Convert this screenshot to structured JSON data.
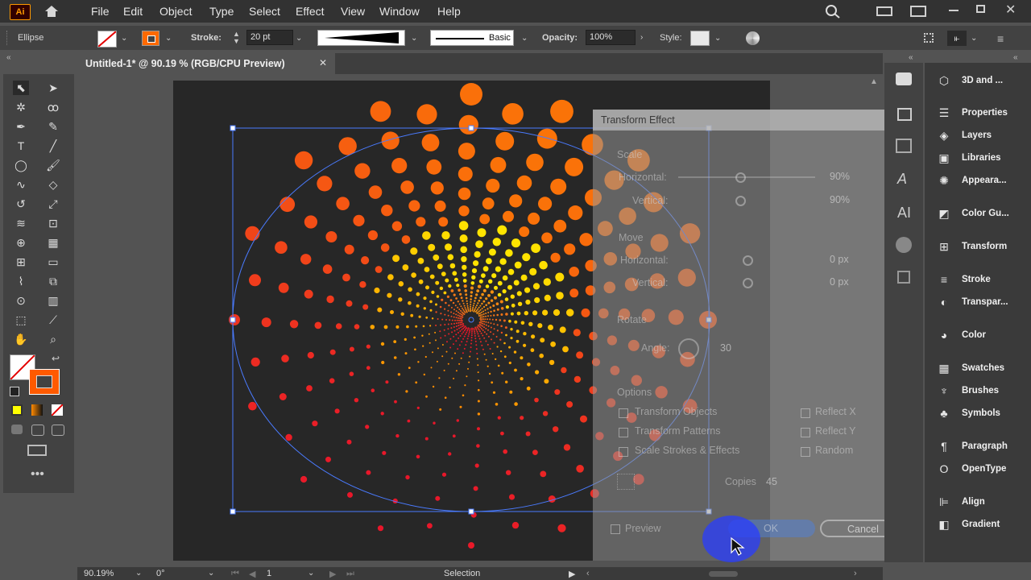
{
  "app": {
    "logo": "Ai"
  },
  "menu": [
    "File",
    "Edit",
    "Object",
    "Type",
    "Select",
    "Effect",
    "View",
    "Window",
    "Help"
  ],
  "control": {
    "selection_label": "Ellipse",
    "stroke_label": "Stroke:",
    "stroke_value": "20 pt",
    "brush_label": "Basic",
    "opacity_label": "Opacity:",
    "opacity_value": "100%",
    "style_label": "Style:"
  },
  "document": {
    "tab_title": "Untitled-1* @ 90.19 % (RGB/CPU Preview)",
    "close": "✕"
  },
  "panels": [
    {
      "label": "3D and ...",
      "icon": "cube-icon"
    },
    {
      "label": "Properties",
      "icon": "properties-icon"
    },
    {
      "label": "Layers",
      "icon": "layers-icon"
    },
    {
      "label": "Libraries",
      "icon": "libraries-icon"
    },
    {
      "label": "Appeara...",
      "icon": "appearance-icon"
    },
    {
      "label": "Color Gu...",
      "icon": "color-guide-icon"
    },
    {
      "label": "Transform",
      "icon": "transform-icon"
    },
    {
      "label": "Stroke",
      "icon": "stroke-icon"
    },
    {
      "label": "Transpar...",
      "icon": "transparency-icon"
    },
    {
      "label": "Color",
      "icon": "color-icon"
    },
    {
      "label": "Swatches",
      "icon": "swatches-icon"
    },
    {
      "label": "Brushes",
      "icon": "brushes-icon"
    },
    {
      "label": "Symbols",
      "icon": "symbols-icon"
    },
    {
      "label": "Paragraph",
      "icon": "paragraph-icon"
    },
    {
      "label": "OpenType",
      "icon": "opentype-icon"
    },
    {
      "label": "Align",
      "icon": "align-icon"
    },
    {
      "label": "Gradient",
      "icon": "gradient-icon"
    }
  ],
  "dialog": {
    "title": "Transform Effect",
    "scale_section": "Scale",
    "horizontal_label": "Horizontal:",
    "horizontal_value": "90%",
    "vertical_label": "Vertical:",
    "vertical_value": "90%",
    "move_section": "Move",
    "move_horizontal_label": "Horizontal:",
    "move_horizontal_value": "0 px",
    "move_vertical_label": "Vertical:",
    "move_vertical_value": "0 px",
    "rotate_section": "Rotate",
    "angle_label": "Angle:",
    "angle_value": "30",
    "options_section": "Options",
    "opt_transform_objects": "Transform Objects",
    "opt_transform_patterns": "Transform Patterns",
    "opt_scale_strokes": "Scale Strokes & Effects",
    "reflect_x": "Reflect X",
    "reflect_y": "Reflect Y",
    "random": "Random",
    "copies_label": "Copies",
    "copies_value": "45",
    "preview_label": "Preview",
    "ok_label": "OK",
    "cancel_label": "Cancel"
  },
  "status": {
    "zoom": "90.19%",
    "rotation": "0°",
    "artboard_number": "1",
    "tool": "Selection"
  },
  "colors": {
    "spiral_inner": "#ffe500",
    "spiral_mid": "#ff8a00",
    "spiral_outer": "#e8162a",
    "selection": "#4a7bff"
  }
}
